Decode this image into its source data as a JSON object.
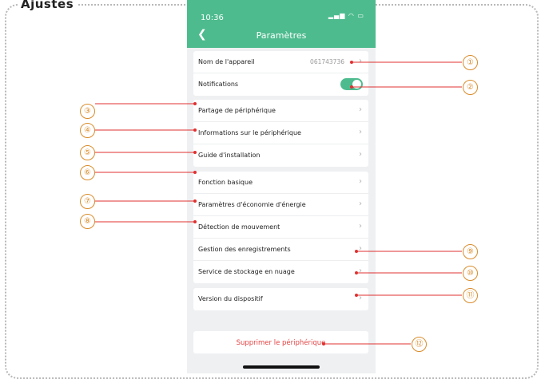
{
  "frame": {
    "caption": "Ajustes"
  },
  "status_bar": {
    "time": "10:36",
    "icons_text": "▂▄▆ ◠ ▭"
  },
  "header": {
    "title": "Paramètres",
    "back_icon": "chevron-left-icon"
  },
  "settings_groups": [
    {
      "rows": [
        {
          "label": "Nom de l'appareil",
          "value": "061743736",
          "chevron": "›"
        },
        {
          "label": "Notifications",
          "toggle_on": true
        }
      ]
    },
    {
      "rows": [
        {
          "label": "Partage de périphérique",
          "chevron": "›"
        },
        {
          "label": "Informations sur le périphérique",
          "chevron": "›"
        },
        {
          "label": "Guide d'installation",
          "chevron": "›"
        }
      ]
    },
    {
      "rows": [
        {
          "label": "Fonction basique",
          "chevron": "›"
        },
        {
          "label": "Paramètres d'économie d'énergie",
          "chevron": "›"
        },
        {
          "label": "Détection de mouvement",
          "chevron": "›"
        },
        {
          "label": "Gestion des enregistrements",
          "chevron": "›"
        },
        {
          "label": "Service de stockage en nuage",
          "chevron": "›"
        }
      ]
    },
    {
      "rows": [
        {
          "label": "Version du dispositif",
          "chevron": "›"
        }
      ]
    }
  ],
  "delete_button": {
    "label": "Supprimer le périphérique"
  },
  "callouts": [
    "①",
    "②",
    "③",
    "④",
    "⑤",
    "⑥",
    "⑦",
    "⑧",
    "⑨",
    "⑩",
    "⑪",
    "⑫"
  ],
  "colors": {
    "accent": "#4dbb8e",
    "danger": "#e24444",
    "callout": "#d98c2b",
    "annotation_line": "#e03030"
  }
}
